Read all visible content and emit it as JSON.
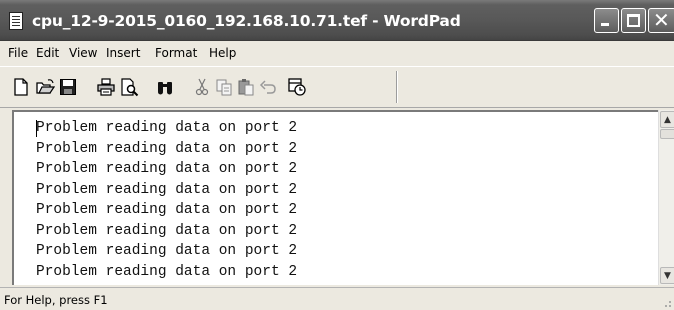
{
  "window": {
    "title": "cpu_12-9-2015_0160_192.168.10.71.tef - WordPad",
    "controls": {
      "minimize_icon": "minimize-icon",
      "maximize_icon": "maximize-icon",
      "close_icon": "close-icon"
    }
  },
  "menu": {
    "items": [
      {
        "label": "File"
      },
      {
        "label": "Edit"
      },
      {
        "label": "View"
      },
      {
        "label": "Insert"
      },
      {
        "label": "Format"
      },
      {
        "label": "Help"
      }
    ]
  },
  "toolbar": {
    "icons": [
      "new-document-icon",
      "open-folder-icon",
      "save-disk-icon",
      "print-icon",
      "print-preview-icon",
      "find-binoculars-icon",
      "cut-scissors-icon",
      "copy-icon",
      "paste-icon",
      "undo-icon",
      "insert-datetime-icon"
    ]
  },
  "document": {
    "lines": [
      "Problem reading data on port 2",
      "Problem reading data on port 2",
      "Problem reading data on port 2",
      "Problem reading data on port 2",
      "Problem reading data on port 2",
      "Problem reading data on port 2",
      "Problem reading data on port 2",
      "Problem reading data on port 2"
    ]
  },
  "status": {
    "text": "For Help, press F1"
  }
}
